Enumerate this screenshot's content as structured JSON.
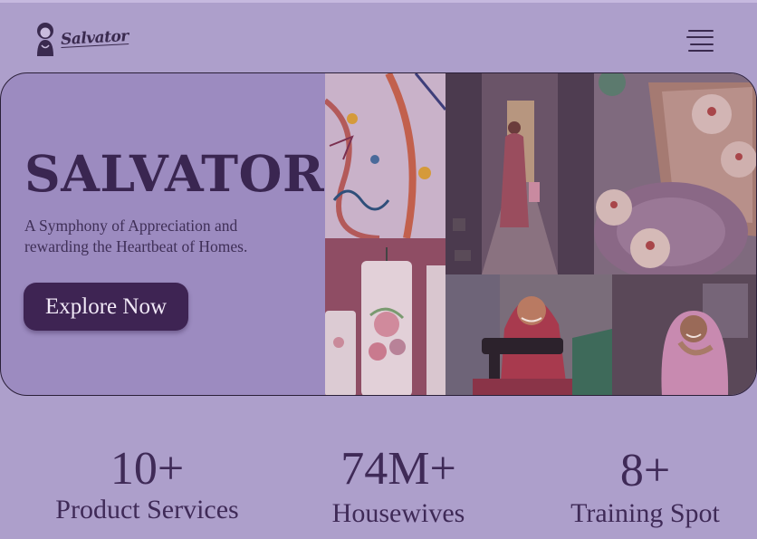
{
  "brand": {
    "logo_text": "Salvator",
    "title": "SALVATOR",
    "tagline_line1": "A Symphony of Appreciation  and",
    "tagline_line2": "rewarding the Heartbeat of Homes."
  },
  "header": {
    "menu_icon": "hamburger-menu-icon"
  },
  "hero": {
    "cta_label": "Explore Now"
  },
  "stats": [
    {
      "value": "10+",
      "label": "Product Services"
    },
    {
      "value": "74M+",
      "label": "Housewives"
    },
    {
      "value": "8+",
      "label": "Training Spot"
    }
  ],
  "colors": {
    "background": "#ad9fcb",
    "hero_panel": "#9c8bc0",
    "cta": "#3e2453",
    "text": "#3f2a57"
  }
}
